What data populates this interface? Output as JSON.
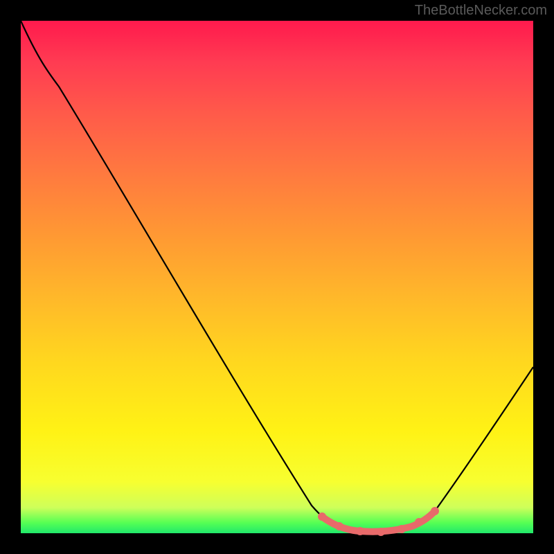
{
  "watermark": "TheBottleNecker.com",
  "chart_data": {
    "type": "line",
    "title": "",
    "xlabel": "",
    "ylabel": "",
    "xlim": [
      0,
      100
    ],
    "ylim": [
      0,
      100
    ],
    "background_gradient": {
      "direction": "vertical",
      "stops": [
        {
          "pos": 0,
          "color": "#ff1a4d"
        },
        {
          "pos": 30,
          "color": "#ff7a3f"
        },
        {
          "pos": 60,
          "color": "#ffd61f"
        },
        {
          "pos": 90,
          "color": "#f7ff30"
        },
        {
          "pos": 100,
          "color": "#20e86b"
        }
      ],
      "meaning": "top=high bottleneck/red, bottom=optimal/green"
    },
    "series": [
      {
        "name": "bottleneck-curve",
        "color": "#000000",
        "x": [
          0,
          5,
          10,
          20,
          30,
          40,
          50,
          57,
          63,
          68,
          72,
          76,
          80,
          85,
          90,
          95,
          100
        ],
        "y": [
          100,
          92,
          88,
          72,
          56,
          40,
          24,
          10,
          3,
          0.5,
          0.3,
          0.5,
          3,
          12,
          22,
          30,
          33
        ]
      },
      {
        "name": "optimal-zone-markers",
        "color": "#e86a6a",
        "x": [
          59,
          62,
          66,
          70,
          74,
          78,
          81
        ],
        "y": [
          3.2,
          1.4,
          0.4,
          0.3,
          0.8,
          2.2,
          4.3
        ]
      }
    ],
    "notes": "Minimum (optimal point) near x≈70. Highlighted marker band spans roughly x∈[59,81]."
  }
}
